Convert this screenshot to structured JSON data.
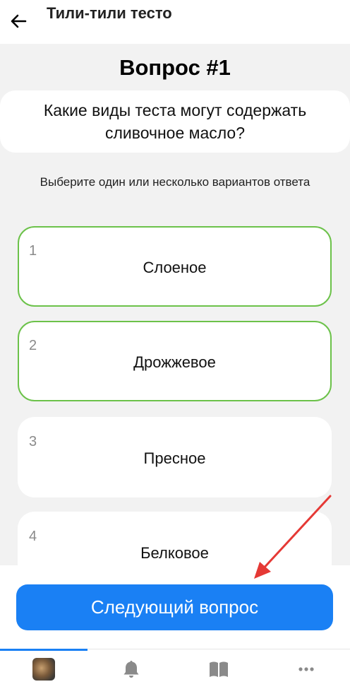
{
  "header": {
    "title": "Тили-тили тесто"
  },
  "question": {
    "title": "Вопрос #1",
    "text": "Какие виды теста могут содержать сливочное масло?",
    "hint": "Выберите один или несколько вариантов ответа"
  },
  "options": [
    {
      "number": "1",
      "label": "Слоеное",
      "selected": true
    },
    {
      "number": "2",
      "label": "Дрожжевое",
      "selected": true
    },
    {
      "number": "3",
      "label": "Пресное",
      "selected": false
    },
    {
      "number": "4",
      "label": "Белковое",
      "selected": false
    }
  ],
  "next_button": {
    "label": "Следующий вопрос"
  },
  "tabs": [
    {
      "icon": "avatar-icon"
    },
    {
      "icon": "bell-icon"
    },
    {
      "icon": "book-icon"
    },
    {
      "icon": "more-icon"
    }
  ],
  "colors": {
    "accent": "#1a80f4",
    "selected_border": "#6cc24a",
    "annotation_arrow": "#e53935"
  }
}
